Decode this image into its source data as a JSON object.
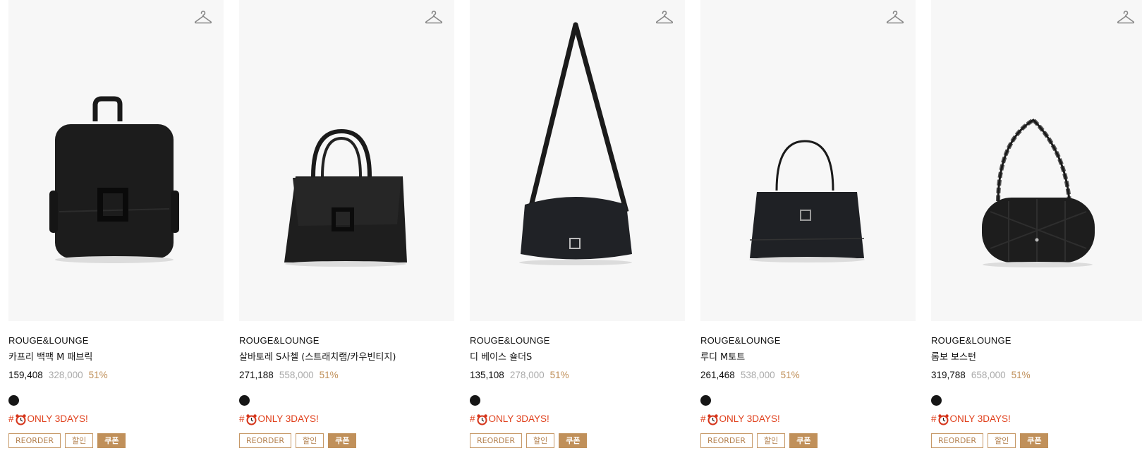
{
  "products": [
    {
      "brand": "ROUGE&LOUNGE",
      "name": "카프리 백팩 M 패브릭",
      "price": "159,408",
      "original_price": "328,000",
      "discount": "51%",
      "color_swatch": "#161616",
      "tag_prefix": "#",
      "tag_text": "ONLY 3DAYS!",
      "badges": [
        "REORDER",
        "할인",
        "쿠폰"
      ]
    },
    {
      "brand": "ROUGE&LOUNGE",
      "name": "살바토레 S사첼 (스트래치램/카우빈티지)",
      "price": "271,188",
      "original_price": "558,000",
      "discount": "51%",
      "color_swatch": "#161616",
      "tag_prefix": "#",
      "tag_text": "ONLY 3DAYS!",
      "badges": [
        "REORDER",
        "할인",
        "쿠폰"
      ]
    },
    {
      "brand": "ROUGE&LOUNGE",
      "name": "디 베이스 숄더S",
      "price": "135,108",
      "original_price": "278,000",
      "discount": "51%",
      "color_swatch": "#161616",
      "tag_prefix": "#",
      "tag_text": "ONLY 3DAYS!",
      "badges": [
        "REORDER",
        "할인",
        "쿠폰"
      ]
    },
    {
      "brand": "ROUGE&LOUNGE",
      "name": "루디 M토트",
      "price": "261,468",
      "original_price": "538,000",
      "discount": "51%",
      "color_swatch": "#161616",
      "tag_prefix": "#",
      "tag_text": "ONLY 3DAYS!",
      "badges": [
        "REORDER",
        "할인",
        "쿠폰"
      ]
    },
    {
      "brand": "ROUGE&LOUNGE",
      "name": "롬보 보스턴",
      "price": "319,788",
      "original_price": "658,000",
      "discount": "51%",
      "color_swatch": "#161616",
      "tag_prefix": "#",
      "tag_text": "ONLY 3DAYS!",
      "badges": [
        "REORDER",
        "할인",
        "쿠폰"
      ]
    }
  ],
  "icons": {
    "wishlist": "hanger-icon",
    "tag_emoji": "alarm-clock-icon"
  },
  "colors": {
    "accent": "#c0905a",
    "tag": "#e0401c",
    "muted": "#aaaaaa"
  }
}
